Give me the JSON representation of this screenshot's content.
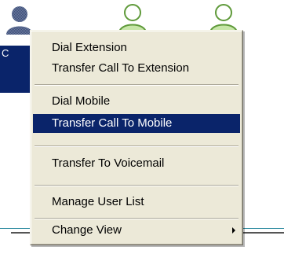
{
  "contacts": {
    "selected_label": "C"
  },
  "context_menu": {
    "items": [
      {
        "label": "Dial Extension"
      },
      {
        "label": "Transfer Call To Extension"
      },
      {
        "label": "Dial Mobile"
      },
      {
        "label": "Transfer Call To Mobile",
        "highlighted": true
      },
      {
        "label": "Transfer To Voicemail"
      },
      {
        "label": "Manage User List"
      },
      {
        "label": "Change View",
        "has_submenu": true,
        "submenu_icon": "chevron-right-icon"
      }
    ]
  },
  "colors": {
    "menu_background": "#ece9d8",
    "highlight": "#0a246a",
    "highlight_text": "#ffffff",
    "contact_green": "#7ab648",
    "divider_teal": "#2e8ba0"
  }
}
